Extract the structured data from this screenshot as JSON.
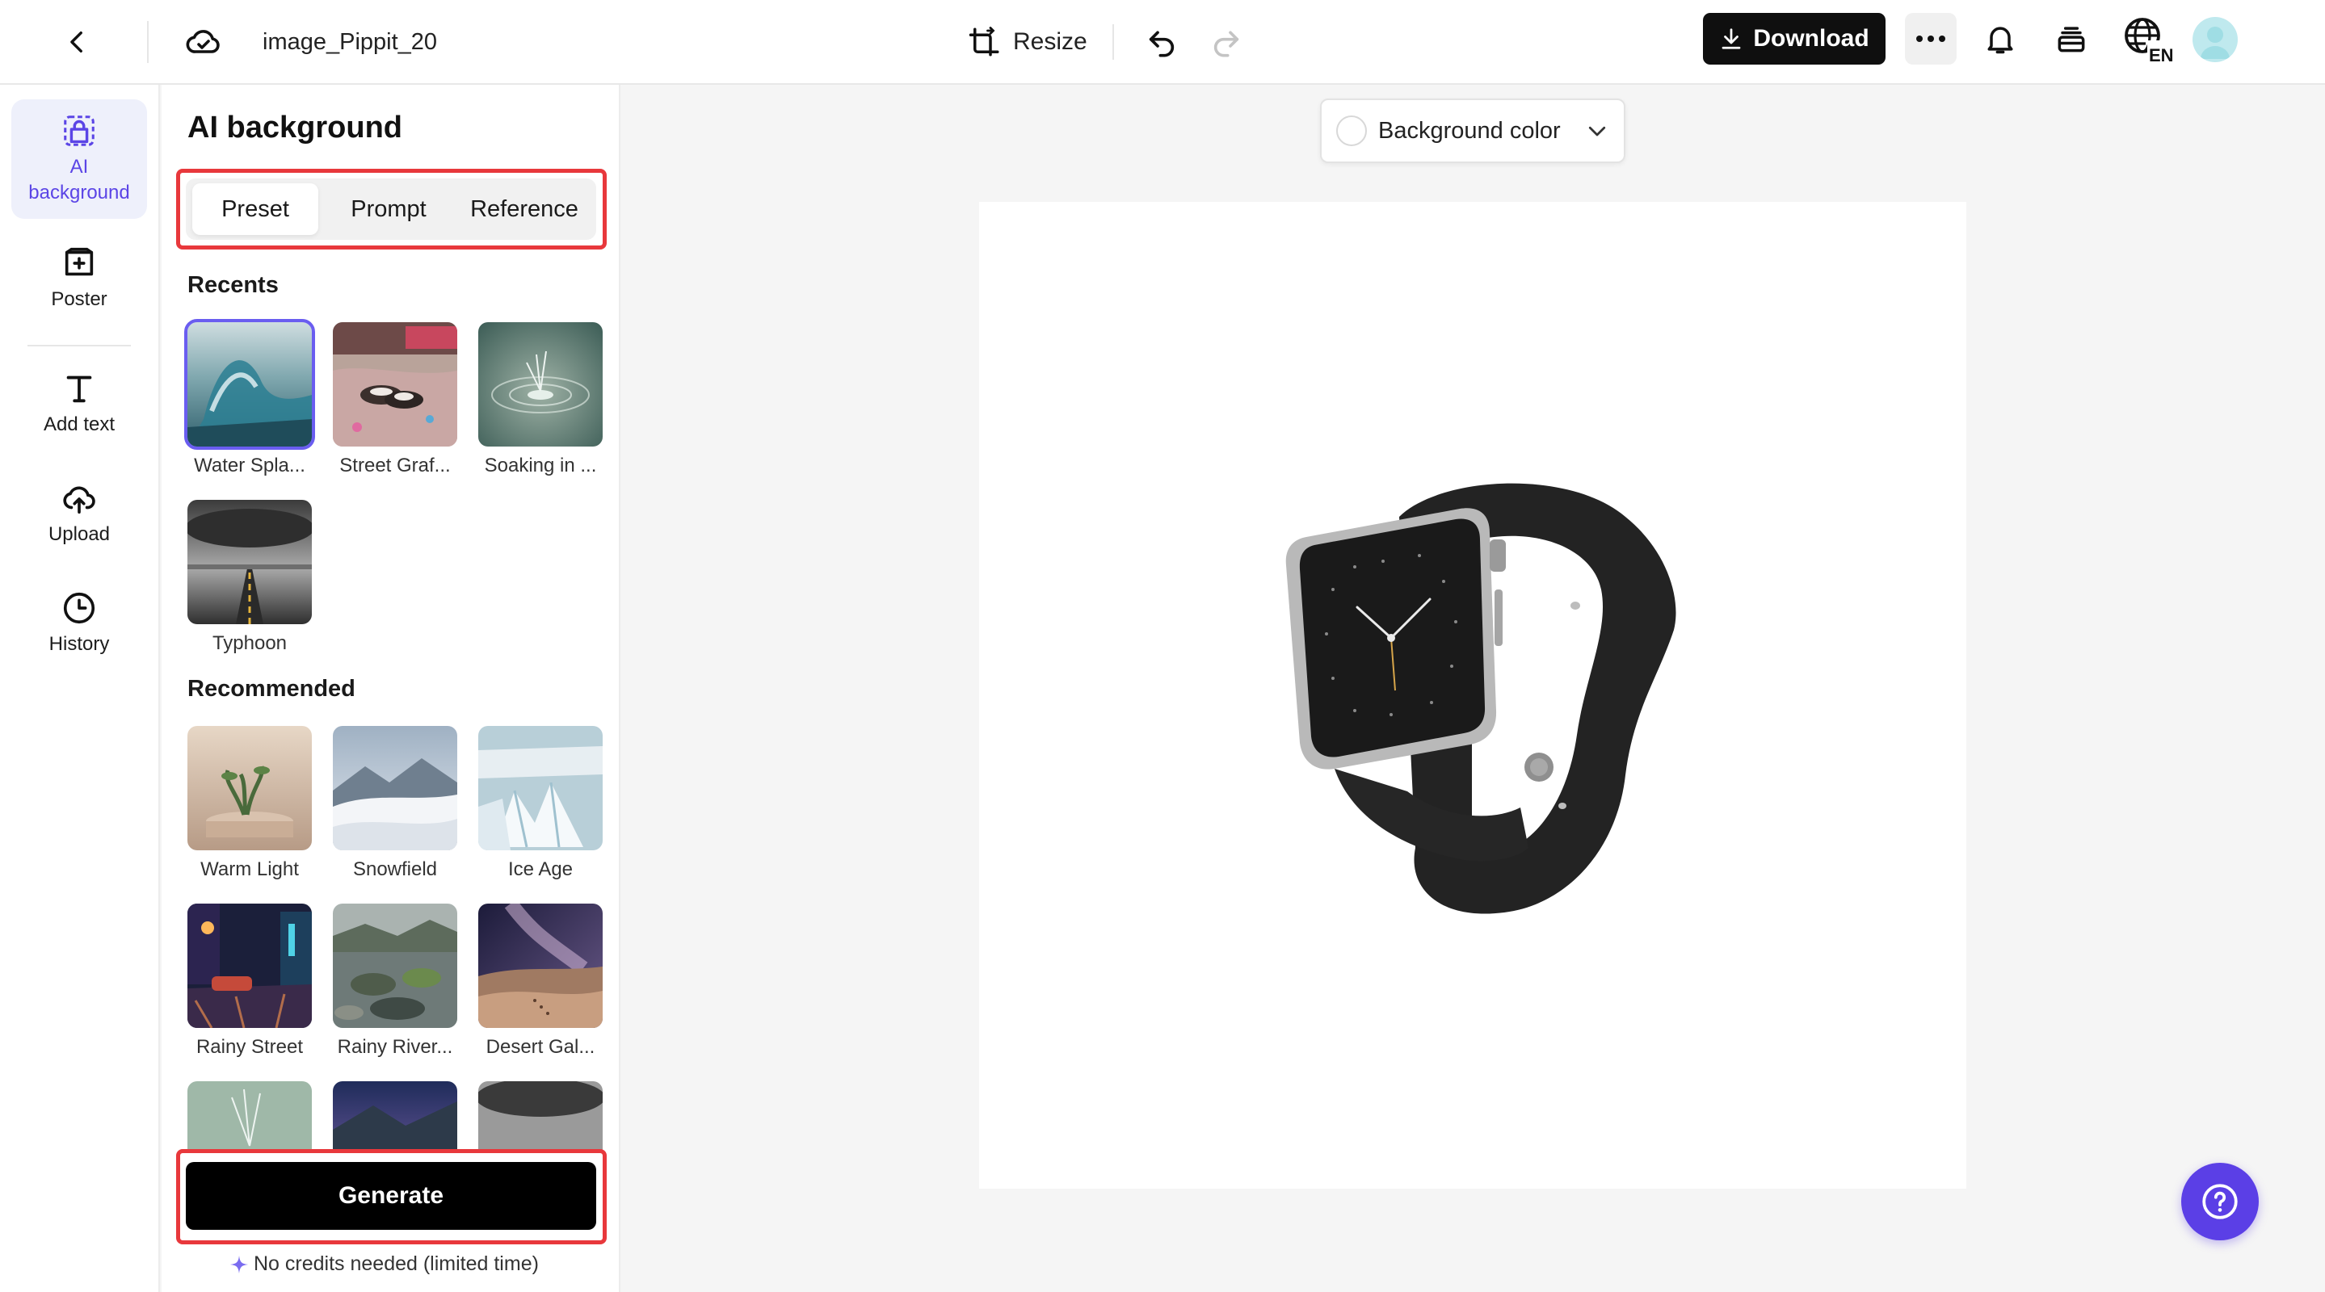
{
  "header": {
    "doc_title": "image_Pippit_20",
    "resize_label": "Resize",
    "download_label": "Download",
    "language_code": "EN"
  },
  "rail": {
    "items": [
      {
        "id": "ai-background",
        "label": "AI\nbackground",
        "active": true
      },
      {
        "id": "poster",
        "label": "Poster"
      },
      {
        "id": "add-text",
        "label": "Add text"
      },
      {
        "id": "upload",
        "label": "Upload"
      },
      {
        "id": "history",
        "label": "History"
      }
    ]
  },
  "panel": {
    "title": "AI background",
    "tabs": [
      {
        "label": "Preset",
        "active": true
      },
      {
        "label": "Prompt"
      },
      {
        "label": "Reference"
      }
    ],
    "recents_heading": "Recents",
    "recents": [
      {
        "label": "Water Spla...",
        "selected": true
      },
      {
        "label": "Street Graf..."
      },
      {
        "label": "Soaking in ..."
      },
      {
        "label": "Typhoon"
      }
    ],
    "recommended_heading": "Recommended",
    "recommended": [
      {
        "label": "Warm Light"
      },
      {
        "label": "Snowfield"
      },
      {
        "label": "Ice Age"
      },
      {
        "label": "Rainy Street"
      },
      {
        "label": "Rainy River..."
      },
      {
        "label": "Desert Gal..."
      }
    ],
    "generate_label": "Generate",
    "credits_note": "No credits needed (limited time)"
  },
  "canvas": {
    "bg_color_label": "Background color"
  },
  "colors": {
    "accent": "#5b45e6",
    "highlight_outline": "#e8383c",
    "primary_button": "#000000",
    "help_button": "#5b3fe6"
  }
}
